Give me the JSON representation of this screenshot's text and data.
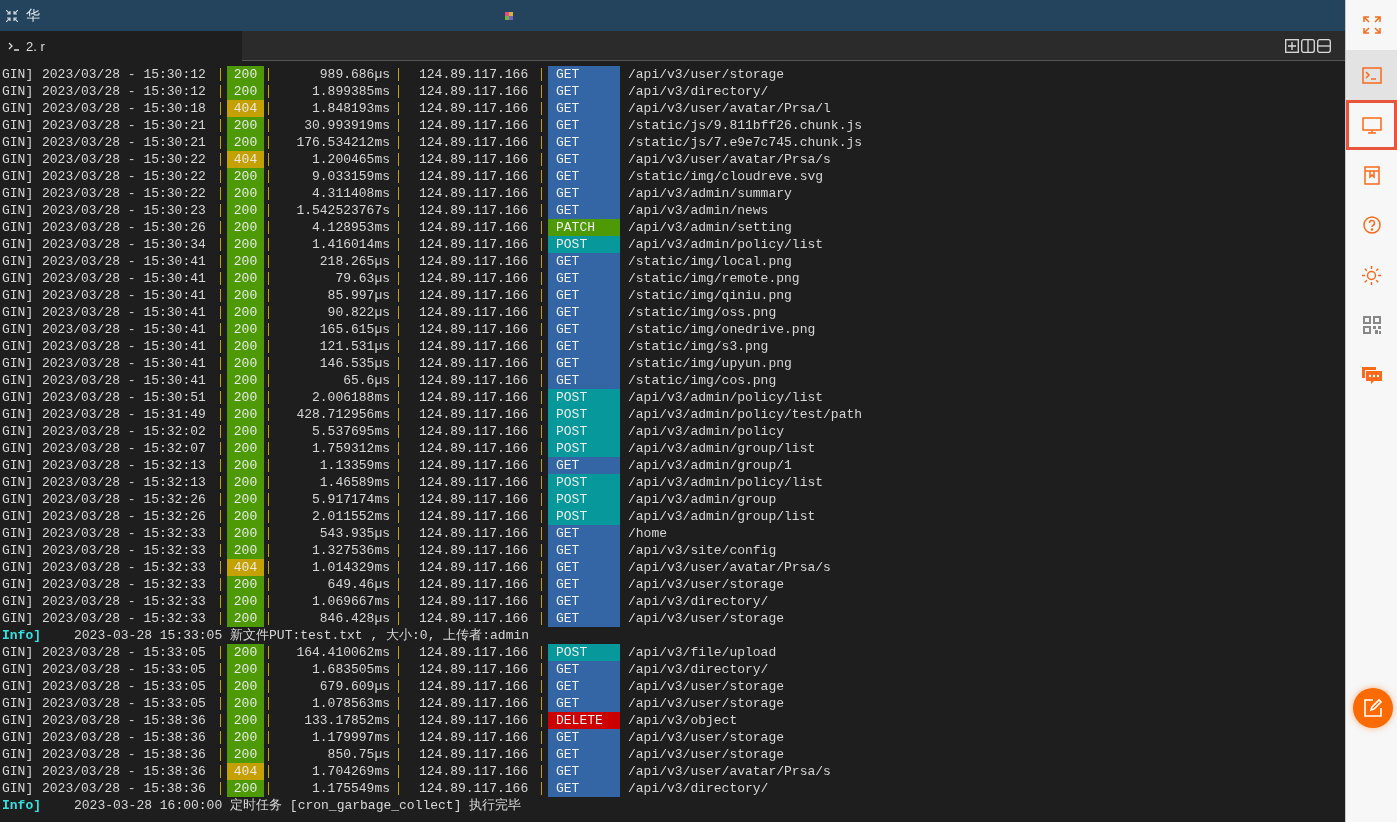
{
  "window": {
    "title": "华"
  },
  "tabs": [
    {
      "label": "2. r",
      "selected": true
    }
  ],
  "terminal": {
    "lines": [
      {
        "kind": "request",
        "prefix": "GIN]",
        "timestamp": "2023/03/28 - 15:30:12",
        "status": {
          "text": "200",
          "color": "#4e9a06"
        },
        "latency": "989.686µs",
        "ip": "124.89.117.166",
        "method": {
          "text": "GET",
          "color": "#3465a4"
        },
        "path": "/api/v3/user/storage"
      },
      {
        "kind": "request",
        "prefix": "GIN]",
        "timestamp": "2023/03/28 - 15:30:12",
        "status": {
          "text": "200",
          "color": "#4e9a06"
        },
        "latency": "1.899385ms",
        "ip": "124.89.117.166",
        "method": {
          "text": "GET",
          "color": "#3465a4"
        },
        "path": "/api/v3/directory/"
      },
      {
        "kind": "request",
        "prefix": "GIN]",
        "timestamp": "2023/03/28 - 15:30:18",
        "status": {
          "text": "404",
          "color": "#c4a000"
        },
        "latency": "1.848193ms",
        "ip": "124.89.117.166",
        "method": {
          "text": "GET",
          "color": "#3465a4"
        },
        "path": "/api/v3/user/avatar/Prsa/l"
      },
      {
        "kind": "request",
        "prefix": "GIN]",
        "timestamp": "2023/03/28 - 15:30:21",
        "status": {
          "text": "200",
          "color": "#4e9a06"
        },
        "latency": "30.993919ms",
        "ip": "124.89.117.166",
        "method": {
          "text": "GET",
          "color": "#3465a4"
        },
        "path": "/static/js/9.811bff26.chunk.js"
      },
      {
        "kind": "request",
        "prefix": "GIN]",
        "timestamp": "2023/03/28 - 15:30:21",
        "status": {
          "text": "200",
          "color": "#4e9a06"
        },
        "latency": "176.534212ms",
        "ip": "124.89.117.166",
        "method": {
          "text": "GET",
          "color": "#3465a4"
        },
        "path": "/static/js/7.e9e7c745.chunk.js"
      },
      {
        "kind": "request",
        "prefix": "GIN]",
        "timestamp": "2023/03/28 - 15:30:22",
        "status": {
          "text": "404",
          "color": "#c4a000"
        },
        "latency": "1.200465ms",
        "ip": "124.89.117.166",
        "method": {
          "text": "GET",
          "color": "#3465a4"
        },
        "path": "/api/v3/user/avatar/Prsa/s"
      },
      {
        "kind": "request",
        "prefix": "GIN]",
        "timestamp": "2023/03/28 - 15:30:22",
        "status": {
          "text": "200",
          "color": "#4e9a06"
        },
        "latency": "9.033159ms",
        "ip": "124.89.117.166",
        "method": {
          "text": "GET",
          "color": "#3465a4"
        },
        "path": "/static/img/cloudreve.svg"
      },
      {
        "kind": "request",
        "prefix": "GIN]",
        "timestamp": "2023/03/28 - 15:30:22",
        "status": {
          "text": "200",
          "color": "#4e9a06"
        },
        "latency": "4.311408ms",
        "ip": "124.89.117.166",
        "method": {
          "text": "GET",
          "color": "#3465a4"
        },
        "path": "/api/v3/admin/summary"
      },
      {
        "kind": "request",
        "prefix": "GIN]",
        "timestamp": "2023/03/28 - 15:30:23",
        "status": {
          "text": "200",
          "color": "#4e9a06"
        },
        "latency": "1.542523767s",
        "ip": "124.89.117.166",
        "method": {
          "text": "GET",
          "color": "#3465a4"
        },
        "path": "/api/v3/admin/news"
      },
      {
        "kind": "request",
        "prefix": "GIN]",
        "timestamp": "2023/03/28 - 15:30:26",
        "status": {
          "text": "200",
          "color": "#4e9a06"
        },
        "latency": "4.128953ms",
        "ip": "124.89.117.166",
        "method": {
          "text": "PATCH",
          "color": "#4e9a06"
        },
        "path": "/api/v3/admin/setting"
      },
      {
        "kind": "request",
        "prefix": "GIN]",
        "timestamp": "2023/03/28 - 15:30:34",
        "status": {
          "text": "200",
          "color": "#4e9a06"
        },
        "latency": "1.416014ms",
        "ip": "124.89.117.166",
        "method": {
          "text": "POST",
          "color": "#06989a"
        },
        "path": "/api/v3/admin/policy/list"
      },
      {
        "kind": "request",
        "prefix": "GIN]",
        "timestamp": "2023/03/28 - 15:30:41",
        "status": {
          "text": "200",
          "color": "#4e9a06"
        },
        "latency": "218.265µs",
        "ip": "124.89.117.166",
        "method": {
          "text": "GET",
          "color": "#3465a4"
        },
        "path": "/static/img/local.png"
      },
      {
        "kind": "request",
        "prefix": "GIN]",
        "timestamp": "2023/03/28 - 15:30:41",
        "status": {
          "text": "200",
          "color": "#4e9a06"
        },
        "latency": "79.63µs",
        "ip": "124.89.117.166",
        "method": {
          "text": "GET",
          "color": "#3465a4"
        },
        "path": "/static/img/remote.png"
      },
      {
        "kind": "request",
        "prefix": "GIN]",
        "timestamp": "2023/03/28 - 15:30:41",
        "status": {
          "text": "200",
          "color": "#4e9a06"
        },
        "latency": "85.997µs",
        "ip": "124.89.117.166",
        "method": {
          "text": "GET",
          "color": "#3465a4"
        },
        "path": "/static/img/qiniu.png"
      },
      {
        "kind": "request",
        "prefix": "GIN]",
        "timestamp": "2023/03/28 - 15:30:41",
        "status": {
          "text": "200",
          "color": "#4e9a06"
        },
        "latency": "90.822µs",
        "ip": "124.89.117.166",
        "method": {
          "text": "GET",
          "color": "#3465a4"
        },
        "path": "/static/img/oss.png"
      },
      {
        "kind": "request",
        "prefix": "GIN]",
        "timestamp": "2023/03/28 - 15:30:41",
        "status": {
          "text": "200",
          "color": "#4e9a06"
        },
        "latency": "165.615µs",
        "ip": "124.89.117.166",
        "method": {
          "text": "GET",
          "color": "#3465a4"
        },
        "path": "/static/img/onedrive.png"
      },
      {
        "kind": "request",
        "prefix": "GIN]",
        "timestamp": "2023/03/28 - 15:30:41",
        "status": {
          "text": "200",
          "color": "#4e9a06"
        },
        "latency": "121.531µs",
        "ip": "124.89.117.166",
        "method": {
          "text": "GET",
          "color": "#3465a4"
        },
        "path": "/static/img/s3.png"
      },
      {
        "kind": "request",
        "prefix": "GIN]",
        "timestamp": "2023/03/28 - 15:30:41",
        "status": {
          "text": "200",
          "color": "#4e9a06"
        },
        "latency": "146.535µs",
        "ip": "124.89.117.166",
        "method": {
          "text": "GET",
          "color": "#3465a4"
        },
        "path": "/static/img/upyun.png"
      },
      {
        "kind": "request",
        "prefix": "GIN]",
        "timestamp": "2023/03/28 - 15:30:41",
        "status": {
          "text": "200",
          "color": "#4e9a06"
        },
        "latency": "65.6µs",
        "ip": "124.89.117.166",
        "method": {
          "text": "GET",
          "color": "#3465a4"
        },
        "path": "/static/img/cos.png"
      },
      {
        "kind": "request",
        "prefix": "GIN]",
        "timestamp": "2023/03/28 - 15:30:51",
        "status": {
          "text": "200",
          "color": "#4e9a06"
        },
        "latency": "2.006188ms",
        "ip": "124.89.117.166",
        "method": {
          "text": "POST",
          "color": "#06989a"
        },
        "path": "/api/v3/admin/policy/list"
      },
      {
        "kind": "request",
        "prefix": "GIN]",
        "timestamp": "2023/03/28 - 15:31:49",
        "status": {
          "text": "200",
          "color": "#4e9a06"
        },
        "latency": "428.712956ms",
        "ip": "124.89.117.166",
        "method": {
          "text": "POST",
          "color": "#06989a"
        },
        "path": "/api/v3/admin/policy/test/path"
      },
      {
        "kind": "request",
        "prefix": "GIN]",
        "timestamp": "2023/03/28 - 15:32:02",
        "status": {
          "text": "200",
          "color": "#4e9a06"
        },
        "latency": "5.537695ms",
        "ip": "124.89.117.166",
        "method": {
          "text": "POST",
          "color": "#06989a"
        },
        "path": "/api/v3/admin/policy"
      },
      {
        "kind": "request",
        "prefix": "GIN]",
        "timestamp": "2023/03/28 - 15:32:07",
        "status": {
          "text": "200",
          "color": "#4e9a06"
        },
        "latency": "1.759312ms",
        "ip": "124.89.117.166",
        "method": {
          "text": "POST",
          "color": "#06989a"
        },
        "path": "/api/v3/admin/group/list"
      },
      {
        "kind": "request",
        "prefix": "GIN]",
        "timestamp": "2023/03/28 - 15:32:13",
        "status": {
          "text": "200",
          "color": "#4e9a06"
        },
        "latency": "1.13359ms",
        "ip": "124.89.117.166",
        "method": {
          "text": "GET",
          "color": "#3465a4"
        },
        "path": "/api/v3/admin/group/1"
      },
      {
        "kind": "request",
        "prefix": "GIN]",
        "timestamp": "2023/03/28 - 15:32:13",
        "status": {
          "text": "200",
          "color": "#4e9a06"
        },
        "latency": "1.46589ms",
        "ip": "124.89.117.166",
        "method": {
          "text": "POST",
          "color": "#06989a"
        },
        "path": "/api/v3/admin/policy/list"
      },
      {
        "kind": "request",
        "prefix": "GIN]",
        "timestamp": "2023/03/28 - 15:32:26",
        "status": {
          "text": "200",
          "color": "#4e9a06"
        },
        "latency": "5.917174ms",
        "ip": "124.89.117.166",
        "method": {
          "text": "POST",
          "color": "#06989a"
        },
        "path": "/api/v3/admin/group"
      },
      {
        "kind": "request",
        "prefix": "GIN]",
        "timestamp": "2023/03/28 - 15:32:26",
        "status": {
          "text": "200",
          "color": "#4e9a06"
        },
        "latency": "2.011552ms",
        "ip": "124.89.117.166",
        "method": {
          "text": "POST",
          "color": "#06989a"
        },
        "path": "/api/v3/admin/group/list"
      },
      {
        "kind": "request",
        "prefix": "GIN]",
        "timestamp": "2023/03/28 - 15:32:33",
        "status": {
          "text": "200",
          "color": "#4e9a06"
        },
        "latency": "543.935µs",
        "ip": "124.89.117.166",
        "method": {
          "text": "GET",
          "color": "#3465a4"
        },
        "path": "/home"
      },
      {
        "kind": "request",
        "prefix": "GIN]",
        "timestamp": "2023/03/28 - 15:32:33",
        "status": {
          "text": "200",
          "color": "#4e9a06"
        },
        "latency": "1.327536ms",
        "ip": "124.89.117.166",
        "method": {
          "text": "GET",
          "color": "#3465a4"
        },
        "path": "/api/v3/site/config"
      },
      {
        "kind": "request",
        "prefix": "GIN]",
        "timestamp": "2023/03/28 - 15:32:33",
        "status": {
          "text": "404",
          "color": "#c4a000"
        },
        "latency": "1.014329ms",
        "ip": "124.89.117.166",
        "method": {
          "text": "GET",
          "color": "#3465a4"
        },
        "path": "/api/v3/user/avatar/Prsa/s"
      },
      {
        "kind": "request",
        "prefix": "GIN]",
        "timestamp": "2023/03/28 - 15:32:33",
        "status": {
          "text": "200",
          "color": "#4e9a06"
        },
        "latency": "649.46µs",
        "ip": "124.89.117.166",
        "method": {
          "text": "GET",
          "color": "#3465a4"
        },
        "path": "/api/v3/user/storage"
      },
      {
        "kind": "request",
        "prefix": "GIN]",
        "timestamp": "2023/03/28 - 15:32:33",
        "status": {
          "text": "200",
          "color": "#4e9a06"
        },
        "latency": "1.069667ms",
        "ip": "124.89.117.166",
        "method": {
          "text": "GET",
          "color": "#3465a4"
        },
        "path": "/api/v3/directory/"
      },
      {
        "kind": "request",
        "prefix": "GIN]",
        "timestamp": "2023/03/28 - 15:32:33",
        "status": {
          "text": "200",
          "color": "#4e9a06"
        },
        "latency": "846.428µs",
        "ip": "124.89.117.166",
        "method": {
          "text": "GET",
          "color": "#3465a4"
        },
        "path": "/api/v3/user/storage"
      },
      {
        "kind": "info",
        "prefix": "Info]",
        "message": "2023-03-28 15:33:05 新文件PUT:test.txt , 大小:0, 上传者:admin"
      },
      {
        "kind": "request",
        "prefix": "GIN]",
        "timestamp": "2023/03/28 - 15:33:05",
        "status": {
          "text": "200",
          "color": "#4e9a06"
        },
        "latency": "164.410062ms",
        "ip": "124.89.117.166",
        "method": {
          "text": "POST",
          "color": "#06989a"
        },
        "path": "/api/v3/file/upload"
      },
      {
        "kind": "request",
        "prefix": "GIN]",
        "timestamp": "2023/03/28 - 15:33:05",
        "status": {
          "text": "200",
          "color": "#4e9a06"
        },
        "latency": "1.683505ms",
        "ip": "124.89.117.166",
        "method": {
          "text": "GET",
          "color": "#3465a4"
        },
        "path": "/api/v3/directory/"
      },
      {
        "kind": "request",
        "prefix": "GIN]",
        "timestamp": "2023/03/28 - 15:33:05",
        "status": {
          "text": "200",
          "color": "#4e9a06"
        },
        "latency": "679.609µs",
        "ip": "124.89.117.166",
        "method": {
          "text": "GET",
          "color": "#3465a4"
        },
        "path": "/api/v3/user/storage"
      },
      {
        "kind": "request",
        "prefix": "GIN]",
        "timestamp": "2023/03/28 - 15:33:05",
        "status": {
          "text": "200",
          "color": "#4e9a06"
        },
        "latency": "1.078563ms",
        "ip": "124.89.117.166",
        "method": {
          "text": "GET",
          "color": "#3465a4"
        },
        "path": "/api/v3/user/storage"
      },
      {
        "kind": "request",
        "prefix": "GIN]",
        "timestamp": "2023/03/28 - 15:38:36",
        "status": {
          "text": "200",
          "color": "#4e9a06"
        },
        "latency": "133.17852ms",
        "ip": "124.89.117.166",
        "method": {
          "text": "DELETE",
          "color": "#cc0000"
        },
        "path": "/api/v3/object"
      },
      {
        "kind": "request",
        "prefix": "GIN]",
        "timestamp": "2023/03/28 - 15:38:36",
        "status": {
          "text": "200",
          "color": "#4e9a06"
        },
        "latency": "1.179997ms",
        "ip": "124.89.117.166",
        "method": {
          "text": "GET",
          "color": "#3465a4"
        },
        "path": "/api/v3/user/storage"
      },
      {
        "kind": "request",
        "prefix": "GIN]",
        "timestamp": "2023/03/28 - 15:38:36",
        "status": {
          "text": "200",
          "color": "#4e9a06"
        },
        "latency": "850.75µs",
        "ip": "124.89.117.166",
        "method": {
          "text": "GET",
          "color": "#3465a4"
        },
        "path": "/api/v3/user/storage"
      },
      {
        "kind": "request",
        "prefix": "GIN]",
        "timestamp": "2023/03/28 - 15:38:36",
        "status": {
          "text": "404",
          "color": "#c4a000"
        },
        "latency": "1.704269ms",
        "ip": "124.89.117.166",
        "method": {
          "text": "GET",
          "color": "#3465a4"
        },
        "path": "/api/v3/user/avatar/Prsa/s"
      },
      {
        "kind": "request",
        "prefix": "GIN]",
        "timestamp": "2023/03/28 - 15:38:36",
        "status": {
          "text": "200",
          "color": "#4e9a06"
        },
        "latency": "1.175549ms",
        "ip": "124.89.117.166",
        "method": {
          "text": "GET",
          "color": "#3465a4"
        },
        "path": "/api/v3/directory/"
      },
      {
        "kind": "info",
        "prefix": "Info]",
        "message": "2023-03-28 16:00:00 定时任务 [cron_garbage_collect] 执行完毕"
      }
    ]
  },
  "sidebar": {
    "items": [
      {
        "kind": "fullscreen",
        "selected": false,
        "highlighted": false
      },
      {
        "kind": "terminal",
        "selected": true,
        "highlighted": false
      },
      {
        "kind": "monitor",
        "selected": false,
        "highlighted": true
      },
      {
        "kind": "book",
        "selected": false,
        "highlighted": false
      },
      {
        "kind": "help",
        "selected": false,
        "highlighted": false
      },
      {
        "kind": "sun",
        "selected": false,
        "highlighted": false
      },
      {
        "kind": "qr",
        "selected": false,
        "highlighted": false
      },
      {
        "kind": "chat",
        "selected": false,
        "highlighted": false
      }
    ]
  }
}
